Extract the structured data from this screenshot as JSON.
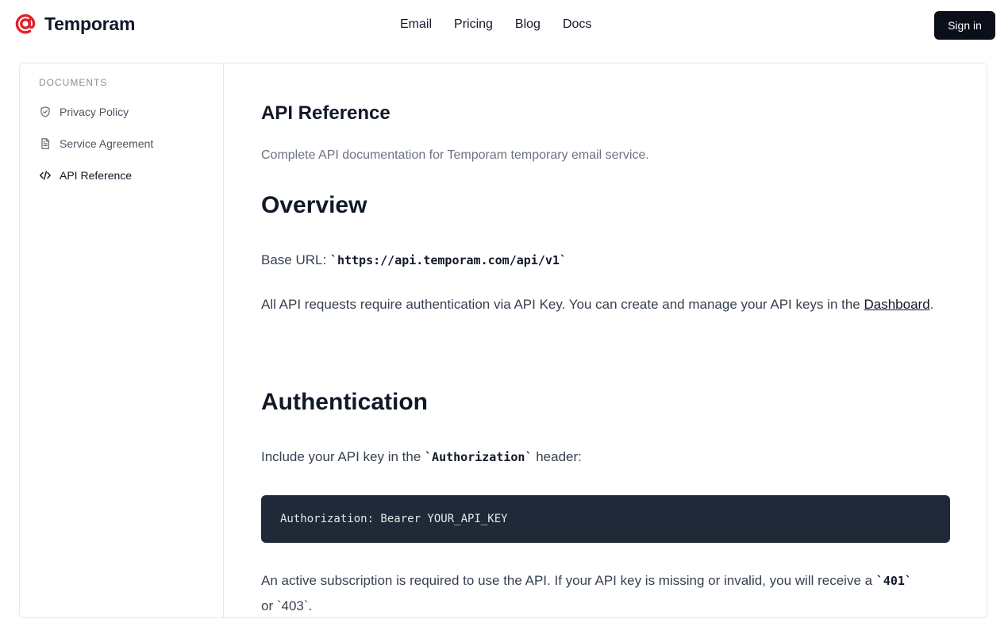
{
  "brand": {
    "name": "Temporam",
    "logo_icon": "at-sign-icon",
    "accent": "#e0242b"
  },
  "nav": {
    "items": [
      "Email",
      "Pricing",
      "Blog",
      "Docs"
    ]
  },
  "header": {
    "signin_label": "Sign in"
  },
  "sidebar": {
    "heading": "DOCUMENTS",
    "items": [
      {
        "label": "Privacy Policy",
        "icon": "shield-icon"
      },
      {
        "label": "Service Agreement",
        "icon": "document-icon"
      },
      {
        "label": "API Reference",
        "icon": "code-icon",
        "active": true
      }
    ]
  },
  "content": {
    "title": "API Reference",
    "subtitle": "Complete API documentation for Temporam temporary email service.",
    "overview": {
      "heading": "Overview",
      "base_url_label": "Base URL: ",
      "base_url_code": "`https://api.temporam.com/api/v1`",
      "auth_text": "All API requests require authentication via API Key. You can create and manage your API keys in the ",
      "dashboard_link": "Dashboard",
      "period": "."
    },
    "authentication": {
      "heading": "Authentication",
      "intro_before": "Include your API key in the ",
      "intro_code": "`Authorization`",
      "intro_after": " header:",
      "code_block": "Authorization: Bearer YOUR_API_KEY",
      "subscription_text": "An active subscription is required to use the API. If your API key is missing or invalid, you will receive a ",
      "code_401": "`401`",
      "trailing": "or `403`."
    }
  }
}
